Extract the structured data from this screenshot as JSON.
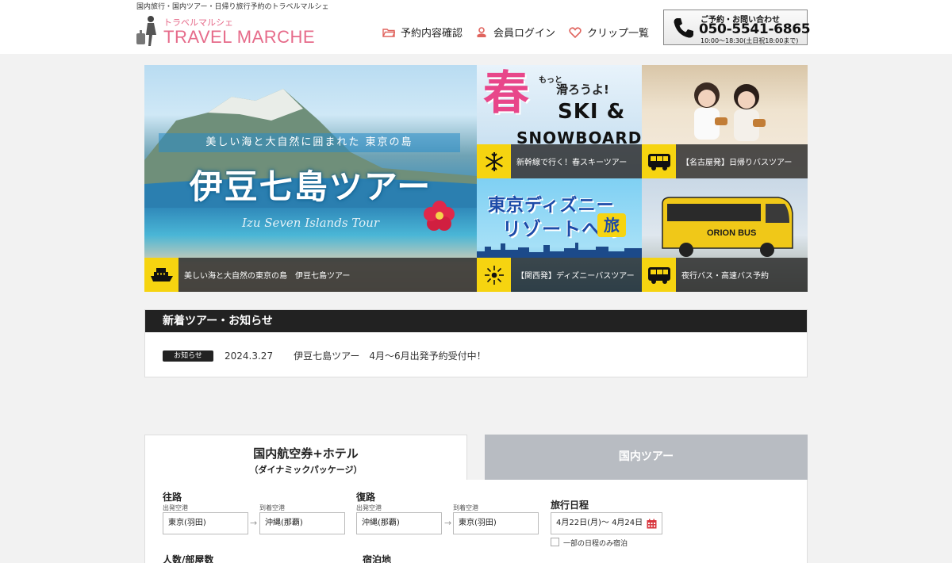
{
  "header": {
    "tagline": "国内旅行・国内ツアー・日帰り旅行予約のトラベルマルシェ",
    "logo_kana": "トラベルマルシェ",
    "logo_text": "TRAVEL MARCHE",
    "nav": {
      "reserve": "予約内容確認",
      "login": "会員ログイン",
      "clip": "クリップ一覧"
    },
    "contact": {
      "label": "ご予約・お問い合わせ",
      "phone": "050-5541-6865",
      "hours": "10:00〜18:30(土日祝18:00まで)"
    }
  },
  "banners": {
    "main": {
      "subtitle": "美しい海と大自然に囲まれた 東京の島",
      "title": "伊豆七島ツアー",
      "english": "Izu Seven Islands Tour",
      "caption": "美しい海と大自然の東京の島　伊豆七島ツアー",
      "icon": "ship-icon"
    },
    "ski": {
      "haru": "春",
      "motto": "もっと",
      "subtitle": "滑ろうよ!",
      "ski_text": "SKI &",
      "snow_text": "SNOWBOARD",
      "caption": "新幹線で行く！春スキーツアー",
      "icon": "snowflake-icon"
    },
    "bus_day": {
      "caption": "【名古屋発】日帰りバスツアー",
      "icon": "bus-icon"
    },
    "disney": {
      "line1": "東京ディズニー",
      "line2": "リゾートへの",
      "tabi": "旅",
      "caption": "【関西発】ディズニーバスツアー",
      "icon": "firework-icon"
    },
    "night_bus": {
      "bus_brand": "ORION BUS",
      "caption": "夜行バス・高速バス予約",
      "icon": "bus-icon"
    }
  },
  "news": {
    "heading": "新着ツアー・お知らせ",
    "items": [
      {
        "badge": "お知らせ",
        "date": "2024.3.27",
        "title": "伊豆七島ツアー　4月〜6月出発予約受付中！"
      }
    ]
  },
  "search": {
    "tab_active_line1": "国内航空券+ホテル",
    "tab_active_line2": "（ダイナミックパッケージ）",
    "tab_inactive": "国内ツアー",
    "outbound": {
      "label": "往路",
      "from_label": "出発空港",
      "from_value": "東京(羽田)",
      "to_label": "到着空港",
      "to_value": "沖縄(那覇)"
    },
    "return": {
      "label": "復路",
      "from_label": "出発空港",
      "from_value": "沖縄(那覇)",
      "to_label": "到着空港",
      "to_value": "東京(羽田)"
    },
    "dates": {
      "label": "旅行日程",
      "value": "4月22日(月)〜  4月24日",
      "partial_stay": "一部の日程のみ宿泊"
    },
    "guests_label": "人数/部屋数",
    "stay_label": "宿泊地"
  },
  "colors": {
    "brand_pink": "#e66b8a",
    "accent_yellow": "#f6d410",
    "dark": "#222222",
    "calendar_red": "#d9363e"
  }
}
